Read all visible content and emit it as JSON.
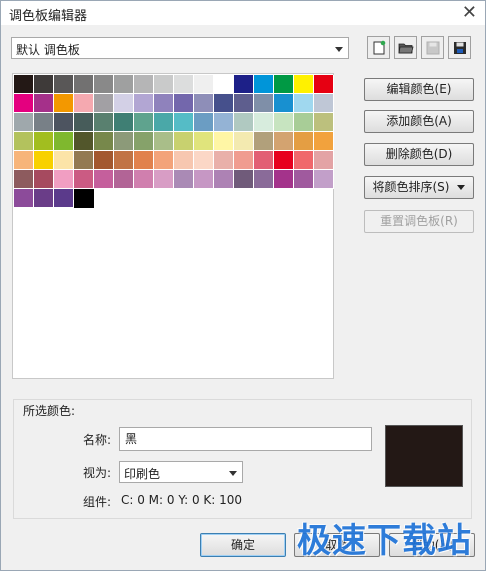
{
  "window": {
    "title": "调色板编辑器"
  },
  "palette_select": {
    "value": "默认 调色板"
  },
  "toolbar": [
    {
      "icon": "new-palette-icon",
      "disabled": false
    },
    {
      "icon": "open-folder-icon",
      "disabled": false
    },
    {
      "icon": "save-icon",
      "disabled": true
    },
    {
      "icon": "save-as-icon",
      "disabled": false
    }
  ],
  "colors": {
    "swatches": [
      "#231815",
      "#3e3a39",
      "#595757",
      "#727171",
      "#898989",
      "#9fa0a0",
      "#b5b5b6",
      "#c9caca",
      "#dcdddd",
      "#efefef",
      "#ffffff",
      "#1d2088",
      "#0095d9",
      "#009944",
      "#fff100",
      "#e60012",
      "#e4007f",
      "#a5308a",
      "#f39800",
      "#f5a9b0",
      "#a2a0a4",
      "#d3d0e6",
      "#b2a6d3",
      "#8f82bc",
      "#7367ac",
      "#8e8eb8",
      "#46508c",
      "#5e5e8e",
      "#7f8fa8",
      "#1890d0",
      "#a0d8ef",
      "#bfc7d6",
      "#9fa8ac",
      "#788087",
      "#4d5460",
      "#475c5a",
      "#59806f",
      "#3f7f74",
      "#5fa38e",
      "#4aa8a8",
      "#55bcc6",
      "#6b9dc3",
      "#94b3d5",
      "#b0c9c1",
      "#d7ecdd",
      "#c7e4c0",
      "#a8cd97",
      "#bcc07d",
      "#b3c25d",
      "#a2be1f",
      "#7fb82e",
      "#52562b",
      "#77884b",
      "#8c9a79",
      "#86a26a",
      "#a9be89",
      "#c8d16f",
      "#e0e47c",
      "#fff6a5",
      "#f3eab0",
      "#b1a07b",
      "#d3a370",
      "#e49e43",
      "#f2a23d",
      "#f7b57a",
      "#f8d100",
      "#fce4a8",
      "#937a52",
      "#a3582f",
      "#c17345",
      "#e1814d",
      "#f3a37a",
      "#f7c7b0",
      "#fbd7c6",
      "#e9b0a9",
      "#f09c90",
      "#e25f74",
      "#e7001e",
      "#f0686c",
      "#e3a3a5",
      "#8d5b5e",
      "#a64a5f",
      "#f19ec2",
      "#cb5b83",
      "#c55f9c",
      "#b26496",
      "#d07fae",
      "#d89dc5",
      "#aa8ab5",
      "#c697c4",
      "#ad82b4",
      "#705b7a",
      "#8a6b99",
      "#a4338b",
      "#a05a9e",
      "#c29fc9",
      "#8c4b9a",
      "#6a3d88",
      "#5b3a8b",
      "#000000"
    ],
    "selected_index": 99
  },
  "buttons": {
    "edit_color": "编辑颜色(E)",
    "add_color": "添加颜色(A)",
    "delete_color": "删除颜色(D)",
    "sort_colors": "将颜色排序(S)",
    "reset_palette": "重置调色板(R)"
  },
  "selected": {
    "group_label": "所选颜色:",
    "name_label": "名称:",
    "name_value": "黑",
    "viewas_label": "视为:",
    "viewas_value": "印刷色",
    "components_label": "组件:",
    "components_value": "C: 0 M: 0 Y: 0 K: 100",
    "preview_color": "#231815"
  },
  "footer": {
    "ok": "确定",
    "cancel": "取消",
    "help": "帮助(H)"
  },
  "watermark": "极速下载站"
}
